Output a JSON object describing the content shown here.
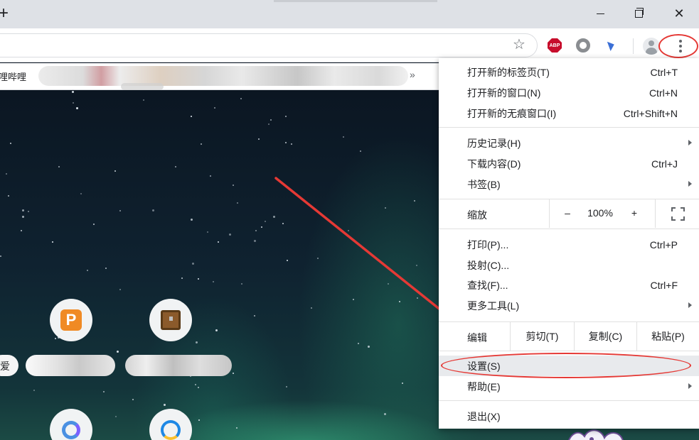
{
  "titlebar": {
    "new_tab_label": "+",
    "close_label": "✕"
  },
  "toolbar": {
    "star_icon": "☆",
    "extensions": [
      {
        "name": "adblock-plus",
        "label": "ABP",
        "color": "#c70d2c"
      },
      {
        "name": "ring-extension",
        "color": "#8a8d91"
      },
      {
        "name": "bird-extension",
        "color": "#3b6fd6"
      }
    ]
  },
  "bookmarks": {
    "first_label": "哩哔哩",
    "more_label": "»"
  },
  "shortcuts": {
    "first_label_fragment": "爱"
  },
  "menu": {
    "group1": [
      {
        "label": "打开新的标签页(T)",
        "shortcut": "Ctrl+T"
      },
      {
        "label": "打开新的窗口(N)",
        "shortcut": "Ctrl+N"
      },
      {
        "label": "打开新的无痕窗口(I)",
        "shortcut": "Ctrl+Shift+N"
      }
    ],
    "group2": [
      {
        "label": "历史记录(H)",
        "shortcut": ""
      },
      {
        "label": "下载内容(D)",
        "shortcut": "Ctrl+J"
      },
      {
        "label": "书签(B)",
        "shortcut": ""
      }
    ],
    "zoom": {
      "label": "缩放",
      "minus": "–",
      "value": "100%",
      "plus": "+"
    },
    "group3": [
      {
        "label": "打印(P)...",
        "shortcut": "Ctrl+P"
      },
      {
        "label": "投射(C)...",
        "shortcut": ""
      },
      {
        "label": "查找(F)...",
        "shortcut": "Ctrl+F"
      },
      {
        "label": "更多工具(L)",
        "shortcut": ""
      }
    ],
    "edit": {
      "label": "编辑",
      "cut": "剪切(T)",
      "copy": "复制(C)",
      "paste": "粘贴(P)"
    },
    "settings_label": "设置(S)",
    "help_label": "帮助(E)",
    "exit_label": "退出(X)"
  },
  "colors": {
    "annotation_red": "#e53935",
    "menu_highlight": "#e8eaed",
    "titlebar_bg": "#dee1e6"
  }
}
